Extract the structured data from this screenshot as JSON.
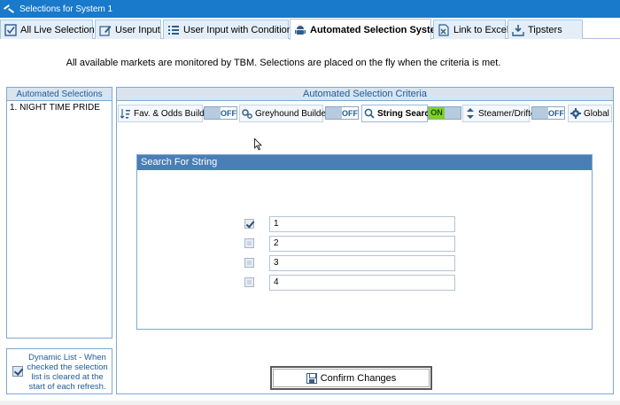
{
  "window": {
    "title": "Selections for System 1"
  },
  "tabs": [
    {
      "label": "All Live Selections",
      "icon": "checkbox-icon"
    },
    {
      "label": "User Input",
      "icon": "edit-icon"
    },
    {
      "label": "User Input with Conditions",
      "icon": "list-icon"
    },
    {
      "label": "Automated Selection Systems",
      "icon": "android-icon"
    },
    {
      "label": "Link to Excel",
      "icon": "excel-icon"
    },
    {
      "label": "Tipsters",
      "icon": "download-icon"
    }
  ],
  "instruction": "All available markets are monitored by TBM. Selections are placed on the fly when the criteria is met.",
  "left_panel": {
    "title": "Automated Selections",
    "items": [
      "1. NIGHT TIME PRIDE"
    ]
  },
  "dynamic_list": {
    "checked": true,
    "label": "Dynamic List - When checked the selection list is cleared at the start of each refresh."
  },
  "criteria": {
    "title": "Automated Selection Criteria",
    "subtabs": [
      {
        "label": "Fav. & Odds Builder",
        "toggle": "OFF"
      },
      {
        "label": "Greyhound Builder",
        "toggle": "OFF"
      },
      {
        "label": "String Search",
        "toggle": "ON"
      },
      {
        "label": "Steamer/Drifter",
        "toggle": "OFF"
      },
      {
        "label": "Global"
      }
    ]
  },
  "search": {
    "title": "Search For String",
    "rows": [
      {
        "checked": true,
        "value": "1"
      },
      {
        "checked": false,
        "value": "2"
      },
      {
        "checked": false,
        "value": "3"
      },
      {
        "checked": false,
        "value": "4"
      }
    ]
  },
  "confirm_label": "Confirm Changes",
  "colors": {
    "titlebar": "#1979ca",
    "toggle_on": "#7ed321",
    "search_header": "#4a7fb5"
  }
}
